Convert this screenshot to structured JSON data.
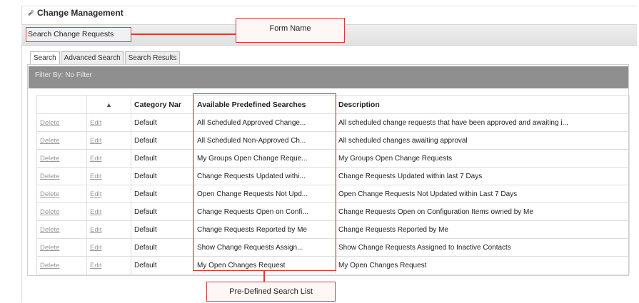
{
  "app": {
    "title": "Change Management"
  },
  "form": {
    "name": "Search Change Requests"
  },
  "callouts": {
    "form_name": "Form Name",
    "search_list": "Pre-Defined Search List"
  },
  "tabs": [
    {
      "label": "Search",
      "active": true
    },
    {
      "label": "Advanced Search",
      "active": false
    },
    {
      "label": "Search Results",
      "active": false
    }
  ],
  "filter": {
    "label": "Filter By: No Filter"
  },
  "table": {
    "sort_indicator": "▲",
    "headers": {
      "category": "Category Nar",
      "available": "Available Predefined Searches",
      "description": "Description"
    },
    "rows": [
      {
        "delete": "Delete",
        "edit": "Edit",
        "category": "Default",
        "available": "All Scheduled Approved Change...",
        "description": "All scheduled change requests that have been approved and awaiting i..."
      },
      {
        "delete": "Delete",
        "edit": "Edit",
        "category": "Default",
        "available": "All Scheduled Non-Approved Ch...",
        "description": "All scheduled changes awaiting approval"
      },
      {
        "delete": "Delete",
        "edit": "Edit",
        "category": "Default",
        "available": "My Groups Open Change Reque...",
        "description": "My Groups Open Change Requests"
      },
      {
        "delete": "Delete",
        "edit": "Edit",
        "category": "Default",
        "available": "Change Requests Updated withi...",
        "description": "Change Requests Updated within last 7 Days"
      },
      {
        "delete": "Delete",
        "edit": "Edit",
        "category": "Default",
        "available": "Open Change Requests Not Upd...",
        "description": "Open Change Requests Not Updated within Last 7 Days"
      },
      {
        "delete": "Delete",
        "edit": "Edit",
        "category": "Default",
        "available": "Change Requests Open on Confi...",
        "description": "Change Requests Open on Configuration Items owned by Me"
      },
      {
        "delete": "Delete",
        "edit": "Edit",
        "category": "Default",
        "available": "Change Requests Reported by Me",
        "description": "Change Requests Reported by Me"
      },
      {
        "delete": "Delete",
        "edit": "Edit",
        "category": "Default",
        "available": "Show Change Requests Assign...",
        "description": "Show Change Requests Assigned to Inactive Contacts"
      },
      {
        "delete": "Delete",
        "edit": "Edit",
        "category": "Default",
        "available": "My Open Changes Request",
        "description": "My Open Changes Request"
      }
    ]
  },
  "colors": {
    "annotation_red": "#c94040",
    "filter_bar": "#8f8f8f",
    "link_gray": "#9a9a9a"
  }
}
